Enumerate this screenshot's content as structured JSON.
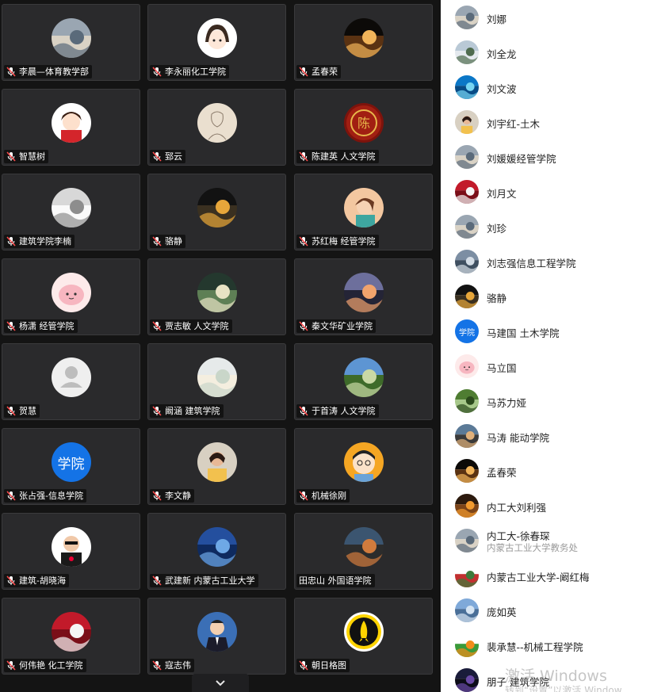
{
  "grid": {
    "tiles": [
      {
        "name": "李晨—体育教学部",
        "avatar": "photo-icon"
      },
      {
        "name": "李永丽化工学院",
        "avatar": "cartoon-girl-icon"
      },
      {
        "name": "孟春荣",
        "avatar": "candles-photo-icon"
      },
      {
        "name": "智慧树",
        "avatar": "cartoon-girl-red-icon"
      },
      {
        "name": "郅云",
        "avatar": "sketch-icon"
      },
      {
        "name": "陈建英  人文学院",
        "avatar": "chen-seal-icon",
        "seal_text": "陈"
      },
      {
        "name": "建筑学院李楠",
        "avatar": "painted-portrait-icon"
      },
      {
        "name": "骆静",
        "avatar": "night-street-icon"
      },
      {
        "name": "苏红梅 经管学院",
        "avatar": "cartoon-woman-icon"
      },
      {
        "name": "杨潇 经管学院",
        "avatar": "pink-cartoon-icon"
      },
      {
        "name": "贾志敏 人文学院",
        "avatar": "flowers-photo-icon"
      },
      {
        "name": "秦文华矿业学院",
        "avatar": "sunset-city-icon"
      },
      {
        "name": "贺慧",
        "avatar": "default-user-icon"
      },
      {
        "name": "阚涵  建筑学院",
        "avatar": "pastel-photo-icon"
      },
      {
        "name": "于首涛 人文学院",
        "avatar": "lighthouse-photo-icon"
      },
      {
        "name": "张占强-信息学院",
        "avatar": "school-badge-icon",
        "badge_text": "学院"
      },
      {
        "name": "李文静",
        "avatar": "woman-photo-icon"
      },
      {
        "name": "机械徐刚",
        "avatar": "cartoon-man-icon"
      },
      {
        "name": "建筑-胡晓海",
        "avatar": "man-sunglasses-icon"
      },
      {
        "name": "武建新 内蒙古工业大学",
        "avatar": "blue-lake-icon"
      },
      {
        "name": "田忠山 外国语学院",
        "avatar": "street-photo-icon",
        "muted": false
      },
      {
        "name": "何伟艳 化工学院",
        "avatar": "red-flower-icon"
      },
      {
        "name": "寇志伟",
        "avatar": "man-suit-icon"
      },
      {
        "name": "朝日格图",
        "avatar": "rocket-logo-icon"
      }
    ]
  },
  "participants": [
    {
      "name": "刘娜",
      "avatar": "photo-icon"
    },
    {
      "name": "刘全龙",
      "avatar": "mountain-photo-icon"
    },
    {
      "name": "刘文波",
      "avatar": "sea-photo-icon"
    },
    {
      "name": "刘宇红-土木",
      "avatar": "woman-photo-icon"
    },
    {
      "name": "刘媛媛经管学院",
      "avatar": "photo-icon"
    },
    {
      "name": "刘月文",
      "avatar": "red-flower-icon"
    },
    {
      "name": "刘珍",
      "avatar": "photo-icon"
    },
    {
      "name": "刘志强信息工程学院",
      "avatar": "city-photo-icon"
    },
    {
      "name": "骆静",
      "avatar": "night-street-icon"
    },
    {
      "name": "马建国 土木学院",
      "avatar": "school-badge-icon",
      "badge_text": "学院"
    },
    {
      "name": "马立国",
      "avatar": "pink-cartoon-icon"
    },
    {
      "name": "马苏力娅",
      "avatar": "tree-photo-icon"
    },
    {
      "name": "马涛 能动学院",
      "avatar": "landscape-photo-icon"
    },
    {
      "name": "孟春荣",
      "avatar": "candles-photo-icon"
    },
    {
      "name": "内工大刘利强",
      "avatar": "sunset-photo-icon"
    },
    {
      "name": "内工大-徐春琛",
      "subtitle": "内蒙古工业大学教务处",
      "avatar": "photo-icon"
    },
    {
      "name": "内蒙古工业大学-阚红梅",
      "avatar": "wreath-icon"
    },
    {
      "name": "庞如英",
      "avatar": "sky-photo-icon"
    },
    {
      "name": "裴承慧--机械工程学院",
      "avatar": "sun-logo-icon"
    },
    {
      "name": "朋子 建筑学院",
      "avatar": "dark-photo-icon"
    }
  ],
  "watermark": {
    "line1": "激活 Windows",
    "line2": "转到“设置”以激活 Window"
  },
  "colors": {
    "grid_bg": "#141414",
    "tile_bg": "#2a2a2c",
    "badge_blue": "#1473e6",
    "mic_red": "#ff4d4f"
  }
}
